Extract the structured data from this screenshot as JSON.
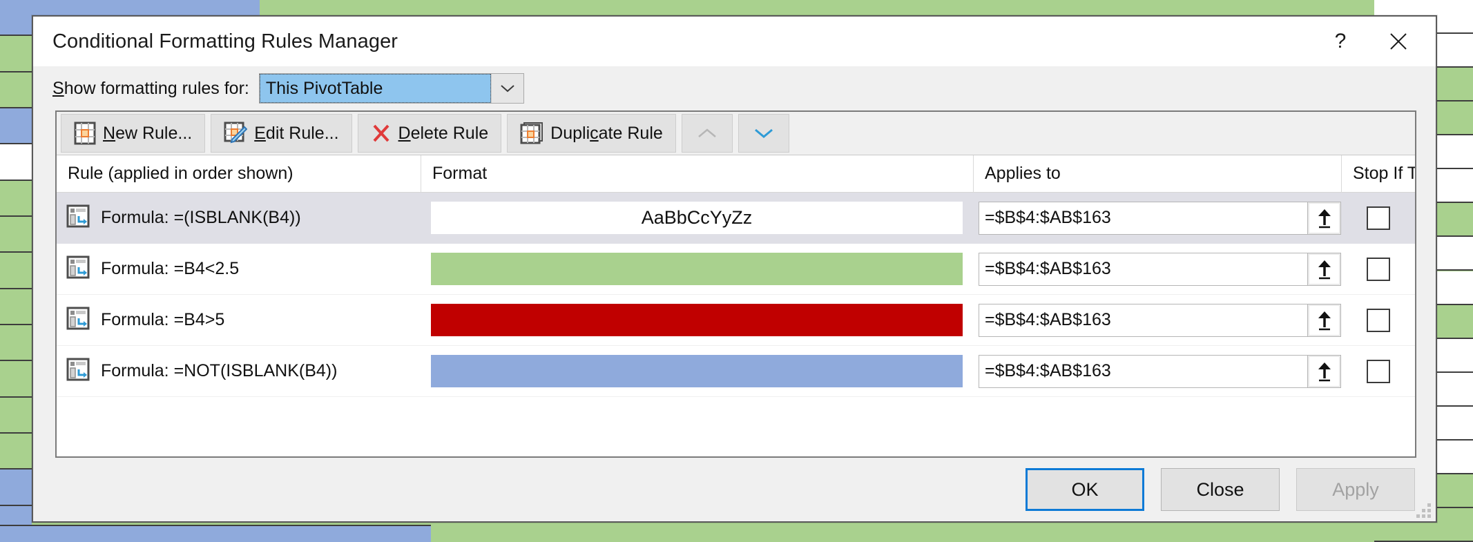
{
  "background": {
    "sheet_fill": "#A9D18E",
    "accent_fill": "#8FAADC",
    "blank_fill": "#FFFFFF"
  },
  "dialog": {
    "title": "Conditional Formatting Rules Manager",
    "help_label": "?",
    "close_label": "✕",
    "show_for": {
      "label_prefix": "S",
      "label_rest": "how formatting rules for:",
      "value": "This PivotTable"
    },
    "toolbar": {
      "new_rule": {
        "pre": "",
        "accel": "N",
        "post": "ew Rule...",
        "icon": "new-rule-grid-icon"
      },
      "edit_rule": {
        "pre": "",
        "accel": "E",
        "post": "dit Rule...",
        "icon": "edit-rule-pencil-icon"
      },
      "delete_rule": {
        "pre": "",
        "accel": "D",
        "post": "elete Rule",
        "icon": "delete-rule-x-icon"
      },
      "duplicate_rule": {
        "pre": "Dupli",
        "accel": "c",
        "post": "ate Rule",
        "icon": "duplicate-rule-grid-icon"
      },
      "move_up": {
        "label": "",
        "icon": "chevron-up-icon",
        "enabled": false
      },
      "move_down": {
        "label": "",
        "icon": "chevron-down-icon",
        "enabled": true
      }
    },
    "columns": {
      "rule": "Rule (applied in order shown)",
      "format": "Format",
      "applies_to": "Applies to",
      "stop_if_true": "Stop If True"
    },
    "rules": [
      {
        "icon": "formula-rule-icon",
        "rule": "Formula: =(ISBLANK(B4))",
        "format_preview_text": "AaBbCcYyZz",
        "format_fill": "#FFFFFF",
        "format_text_color": "#111111",
        "applies_to": "=$B$4:$AB$163",
        "picker_icon": "range-collapse-icon",
        "stop_if_true": false,
        "selected": true
      },
      {
        "icon": "formula-rule-icon",
        "rule": "Formula: =B4<2.5",
        "format_preview_text": "",
        "format_fill": "#A9D18E",
        "format_text_color": "#111111",
        "applies_to": "=$B$4:$AB$163",
        "picker_icon": "range-collapse-icon",
        "stop_if_true": false,
        "selected": false
      },
      {
        "icon": "formula-rule-icon",
        "rule": "Formula: =B4>5",
        "format_preview_text": "",
        "format_fill": "#C00000",
        "format_text_color": "#FFFFFF",
        "applies_to": "=$B$4:$AB$163",
        "picker_icon": "range-collapse-icon",
        "stop_if_true": false,
        "selected": false
      },
      {
        "icon": "formula-rule-icon",
        "rule": "Formula: =NOT(ISBLANK(B4))",
        "format_preview_text": "",
        "format_fill": "#8FAADC",
        "format_text_color": "#111111",
        "applies_to": "=$B$4:$AB$163",
        "picker_icon": "range-collapse-icon",
        "stop_if_true": false,
        "selected": false
      }
    ],
    "footer": {
      "ok": "OK",
      "close": "Close",
      "apply": "Apply",
      "apply_enabled": false
    }
  }
}
